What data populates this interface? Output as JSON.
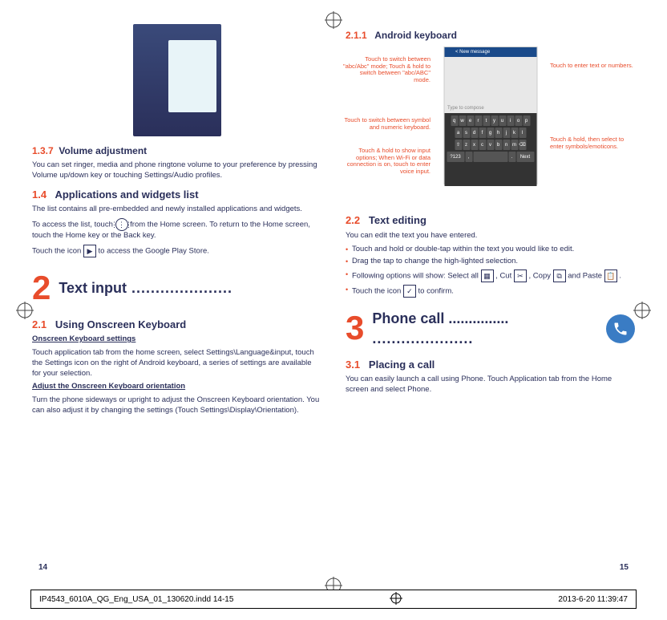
{
  "left": {
    "sec137_num": "1.3.7",
    "sec137_title": "Volume adjustment",
    "sec137_body": "You can set ringer, media and phone ringtone volume to your preference by pressing Volume up/down key or touching Settings/Audio profiles.",
    "sec14_num": "1.4",
    "sec14_title": "Applications and widgets list",
    "sec14_p1": "The list contains all pre-embedded and newly installed applications and widgets.",
    "sec14_p2a": "To access the list, touch ",
    "sec14_p2b": " from the Home screen. To return to the Home screen, touch the Home key or the Back key.",
    "sec14_p3a": "Touch the icon ",
    "sec14_p3b": " to access the Google Play Store.",
    "ch2_num": "2",
    "ch2_title": "Text input",
    "sec21_num": "2.1",
    "sec21_title": "Using Onscreen Keyboard",
    "sec21_h1": "Onscreen Keyboard settings",
    "sec21_p1": "Touch application tab from the home screen, select Settings\\Language&input, touch the Settings icon  on the right of Android keyboard, a series of settings are available for your selection.",
    "sec21_h2": "Adjust the Onscreen Keyboard orientation",
    "sec21_p2": "Turn the phone sideways or upright to adjust the Onscreen Keyboard orientation. You can also adjust it by changing the settings (Touch Settings\\Display\\Orientation).",
    "page": "14"
  },
  "right": {
    "sec211_num": "2.1.1",
    "sec211_title": "Android keyboard",
    "kb_topbar": "New message",
    "kb_compose": "Type to compose",
    "callout_modeswitch": "Touch to switch between \"abc/Abc\" mode; Touch & hold to switch between \"abc/ABC\" mode.",
    "callout_entertext": "Touch to enter text or numbers.",
    "callout_symbol": "Touch to switch between symbol and numeric keyboard.",
    "callout_hold": "Touch & hold, then select to enter symbols/emoticons.",
    "callout_voice": "Touch & hold to show input options; When Wi-Fi or data connection is on, touch to enter voice input.",
    "sec22_num": "2.2",
    "sec22_title": "Text editing",
    "sec22_intro": "You can edit the text you have entered.",
    "sec22_b1": "Touch and hold or double-tap within the text you would like to edit.",
    "sec22_b2": "Drag the tap to change the high-lighted selection.",
    "sec22_b3a": "Following options will show: Select all ",
    "sec22_b3b": " , Cut ",
    "sec22_b3c": " , Copy ",
    "sec22_b3d": " and Paste ",
    "sec22_b3e": ".",
    "sec22_b4a": "Touch the icon ",
    "sec22_b4b": " to confirm.",
    "ch3_num": "3",
    "ch3_title": "Phone call",
    "sec31_num": "3.1",
    "sec31_title": "Placing a call",
    "sec31_body": "You can easily launch a call using Phone. Touch Application tab from the Home screen and select Phone.",
    "page": "15"
  },
  "footer": {
    "file": "IP4543_6010A_QG_Eng_USA_01_130620.indd   14-15",
    "stamp": "2013-6-20   11:39:47"
  },
  "keyboard_rows": {
    "r1": [
      "q",
      "w",
      "e",
      "r",
      "t",
      "y",
      "u",
      "i",
      "o",
      "p"
    ],
    "r2": [
      "a",
      "s",
      "d",
      "f",
      "g",
      "h",
      "j",
      "k",
      "l"
    ],
    "r3": [
      "⇧",
      "z",
      "x",
      "c",
      "v",
      "b",
      "n",
      "m",
      "⌫"
    ]
  }
}
